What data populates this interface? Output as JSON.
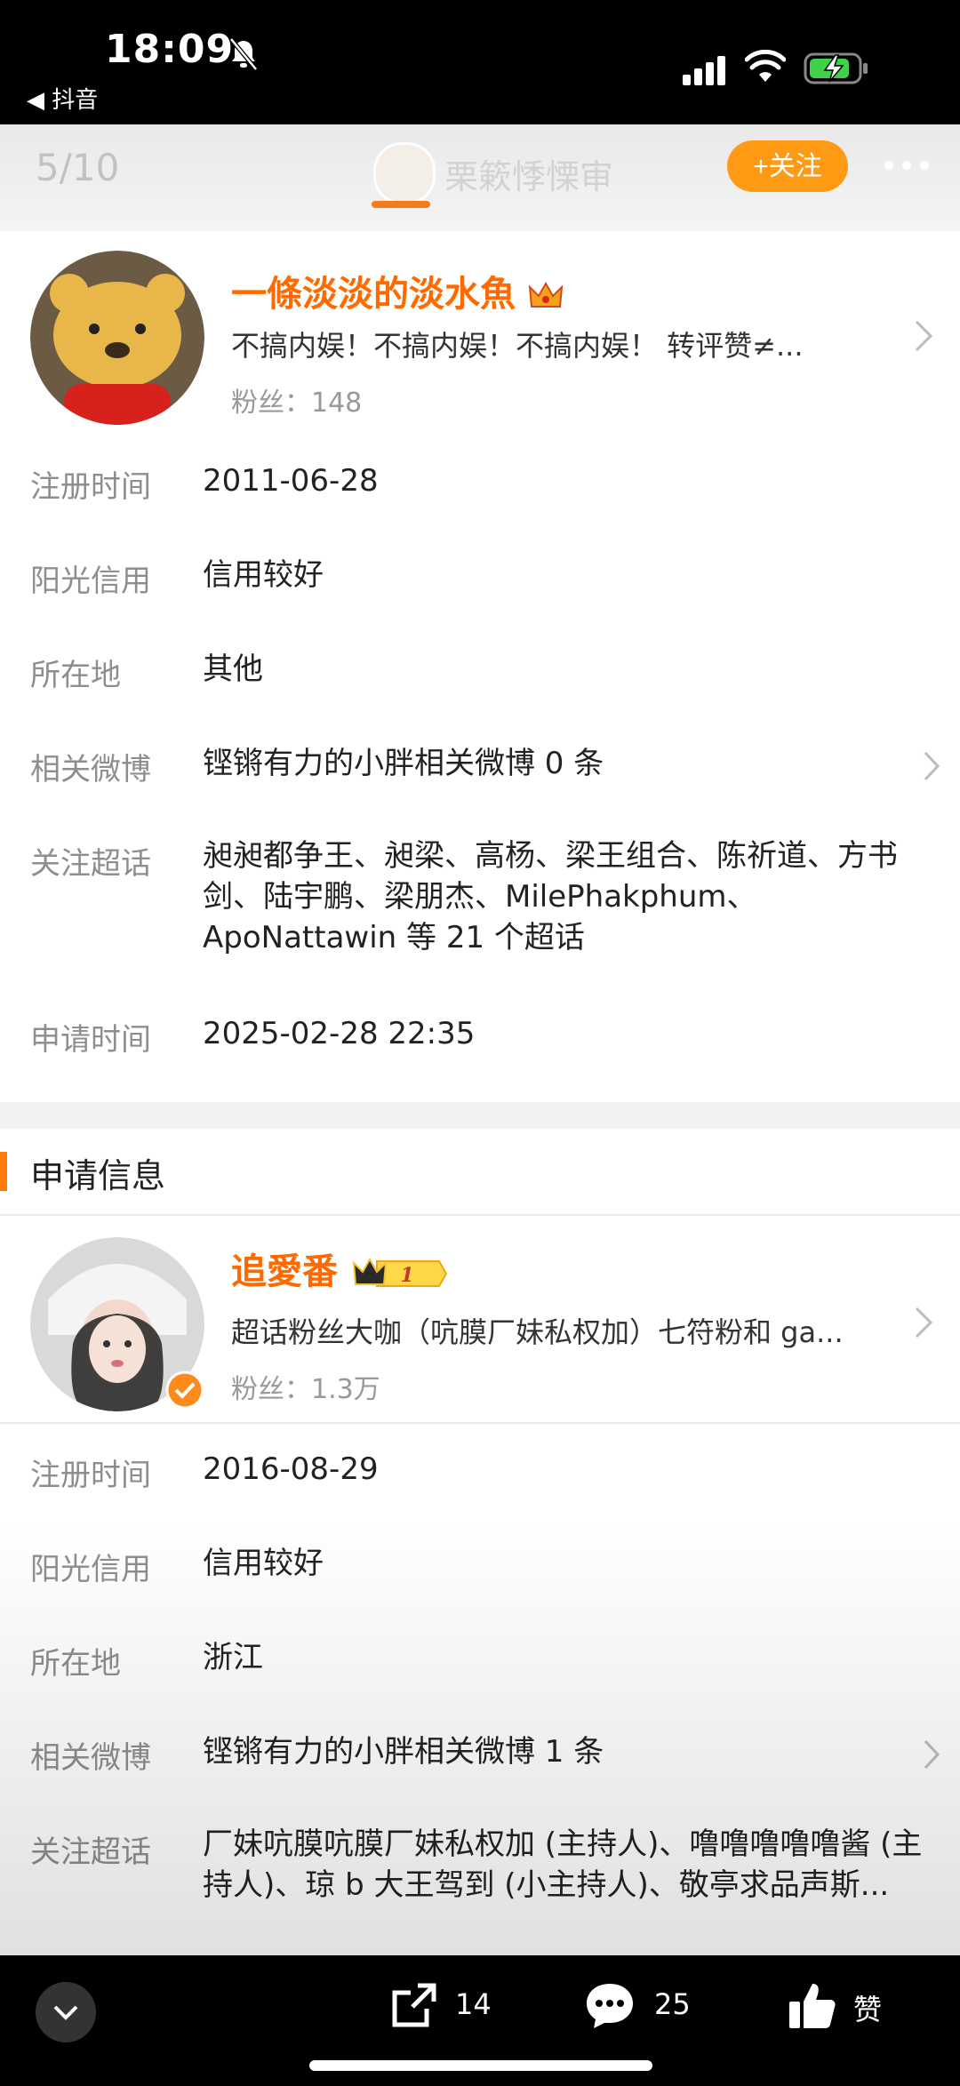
{
  "status_bar": {
    "time": "18:09",
    "back_app": "◀ 抖音",
    "bell_muted": true
  },
  "header": {
    "pager": "5/10",
    "title": "栗簌悸慄审",
    "follow_button": "+关注"
  },
  "profile1": {
    "name": "一條淡淡的淡水魚",
    "bio": "不搞内娱！不搞内娱！不搞内娱！ 转评赞≠...",
    "fans_label": "粉丝：",
    "fans": "148"
  },
  "profile1_rows": [
    {
      "label": "注册时间",
      "value": "2011-06-28"
    },
    {
      "label": "阳光信用",
      "value": "信用较好"
    },
    {
      "label": "所在地",
      "value": "其他"
    },
    {
      "label": "相关微博",
      "value": "铿锵有力的小胖相关微博 0 条"
    },
    {
      "label": "关注超话",
      "value": "昶昶都争王、昶梁、高杨、梁王组合、陈祈道、方书剑、陆宇鹏、梁朋杰、MilePhakphum、ApoNattawin 等 21 个超话"
    },
    {
      "label": "申请时间",
      "value": "2025-02-28 22:35"
    }
  ],
  "section": {
    "title": "申请信息"
  },
  "profile2": {
    "name": "追愛番",
    "badge_level": "1",
    "bio": "超话粉丝大咖（吭膜厂妹私权加）七符粉和 ga...",
    "fans_label": "粉丝：",
    "fans": "1.3万"
  },
  "profile2_rows": [
    {
      "label": "注册时间",
      "value": "2016-08-29"
    },
    {
      "label": "阳光信用",
      "value": "信用较好"
    },
    {
      "label": "所在地",
      "value": "浙江"
    },
    {
      "label": "相关微博",
      "value": "铿锵有力的小胖相关微博 1 条"
    },
    {
      "label": "关注超话",
      "value": "厂妹吭膜吭膜厂妹私权加 (主持人)、噜噜噜噜噜酱 (主持人)、琼 b 大王驾到 (小主持人)、敬亭求品声斯..."
    }
  ],
  "bottom_bar": {
    "share_count": "14",
    "comment_count": "25",
    "like_label": "赞"
  },
  "colors": {
    "accent": "#ff9a14",
    "name": "#ff6a00",
    "section_bar": "#ff7a0a"
  }
}
